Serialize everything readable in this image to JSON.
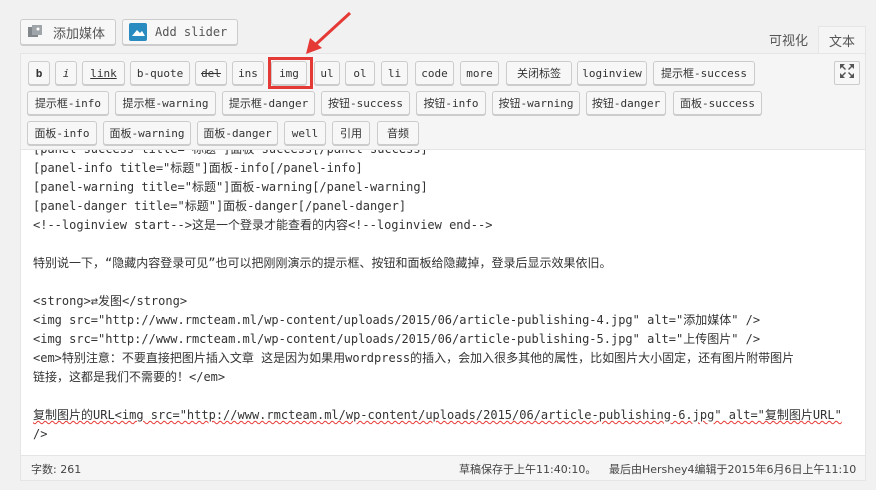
{
  "media_buttons": {
    "add_media": "添加媒体",
    "add_slider": "Add slider"
  },
  "mode_tabs": [
    "可视化",
    "文本"
  ],
  "active_tab": "文本",
  "quicktags": [
    "b",
    "i",
    "link",
    "b-quote",
    "del",
    "ins",
    "img",
    "ul",
    "ol",
    "li",
    "code",
    "more",
    "关闭标签",
    "loginview",
    "提示框-success",
    "提示框-info",
    "提示框-warning",
    "提示框-danger",
    "按钮-success",
    "按钮-info",
    "按钮-warning",
    "按钮-danger",
    "面板-success",
    "面板-info",
    "面板-warning",
    "面板-danger",
    "well",
    "引用",
    "音频"
  ],
  "highlighted_button": "img",
  "content_lines": [
    "[panel-success title=\"标题\"]面板-success[/panel-success]",
    "[panel-info title=\"标题\"]面板-info[/panel-info]",
    "[panel-warning title=\"标题\"]面板-warning[/panel-warning]",
    "[panel-danger title=\"标题\"]面板-danger[/panel-danger]",
    "<!--loginview start-->这是一个登录才能查看的内容<!--loginview end-->",
    "",
    "特别说一下，“隐藏内容登录可见”也可以把刚刚演示的提示框、按钮和面板给隐藏掉，登录后显示效果依旧。",
    "",
    "<strong>⇄发图</strong>",
    "<img src=\"http://www.rmcteam.ml/wp-content/uploads/2015/06/article-publishing-4.jpg\" alt=\"添加媒体\" />",
    "<img src=\"http://www.rmcteam.ml/wp-content/uploads/2015/06/article-publishing-5.jpg\" alt=\"上传图片\" />",
    "<em>特别注意：不要直接把图片插入文章 这是因为如果用wordpress的插入，会加入很多其他的属性，比如图片大小固定，还有图片附带图片",
    "链接，这都是我们不需要的！</em>",
    "",
    "复制图片的URL<img src=\"http://www.rmcteam.ml/wp-content/uploads/2015/06/article-publishing-6.jpg\" alt=\"复制图片URL\"",
    "/>"
  ],
  "status": {
    "word_count": "字数: 261",
    "draft_saved": "草稿保存于上午11:40:10。",
    "last_edited": "最后由Hershey4编辑于2015年6月6日上午11:10"
  },
  "colors": {
    "highlight": "#e53935",
    "toolbar_bg": "#f5f5f5",
    "editor_bg": "#ffffff"
  }
}
